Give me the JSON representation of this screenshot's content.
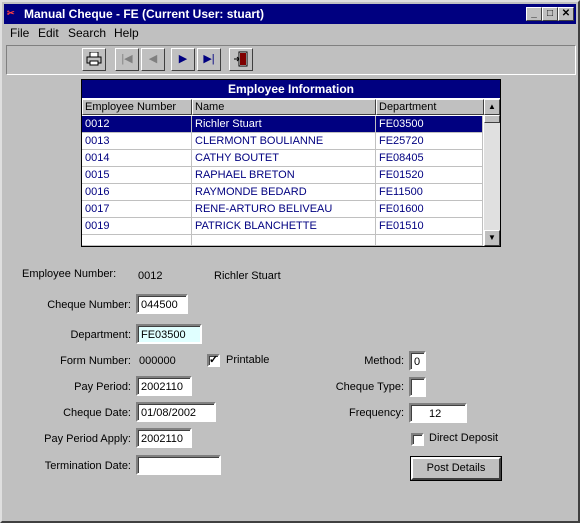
{
  "window": {
    "title": "Manual Cheque - FE (Current User: stuart)"
  },
  "menu": {
    "file": "File",
    "edit": "Edit",
    "search": "Search",
    "help": "Help"
  },
  "grid": {
    "title": "Employee Information",
    "columns": [
      "Employee Number",
      "Name",
      "Department"
    ],
    "rows": [
      [
        "0012",
        "Richler Stuart",
        "FE03500"
      ],
      [
        "0013",
        "CLERMONT BOULIANNE",
        "FE25720"
      ],
      [
        "0014",
        "CATHY BOUTET",
        "FE08405"
      ],
      [
        "0015",
        "RAPHAEL BRETON",
        "FE01520"
      ],
      [
        "0016",
        "RAYMONDE BEDARD",
        "FE11500"
      ],
      [
        "0017",
        "RENE-ARTURO BELIVEAU",
        "FE01600"
      ],
      [
        "0019",
        "PATRICK BLANCHETTE",
        "FE01510"
      ]
    ]
  },
  "form": {
    "employee_number_label": "Employee Number:",
    "employee_number": "0012",
    "employee_name": "Richler Stuart",
    "cheque_number_label": "Cheque Number:",
    "cheque_number": "044500",
    "department_label": "Department:",
    "department": "FE03500",
    "form_number_label": "Form Number:",
    "form_number": "000000",
    "printable_label": "Printable",
    "printable_checked": "✓",
    "pay_period_label": "Pay Period:",
    "pay_period": "2002110",
    "cheque_date_label": "Cheque Date:",
    "cheque_date": "01/08/2002",
    "pay_period_apply_label": "Pay Period Apply:",
    "pay_period_apply": "2002110",
    "termination_date_label": "Termination Date:",
    "termination_date": "",
    "method_label": "Method:",
    "method": "0",
    "cheque_type_label": "Cheque Type:",
    "cheque_type": "",
    "frequency_label": "Frequency:",
    "frequency": "12",
    "direct_deposit_label": "Direct Deposit",
    "post_details_button": "Post Details"
  }
}
